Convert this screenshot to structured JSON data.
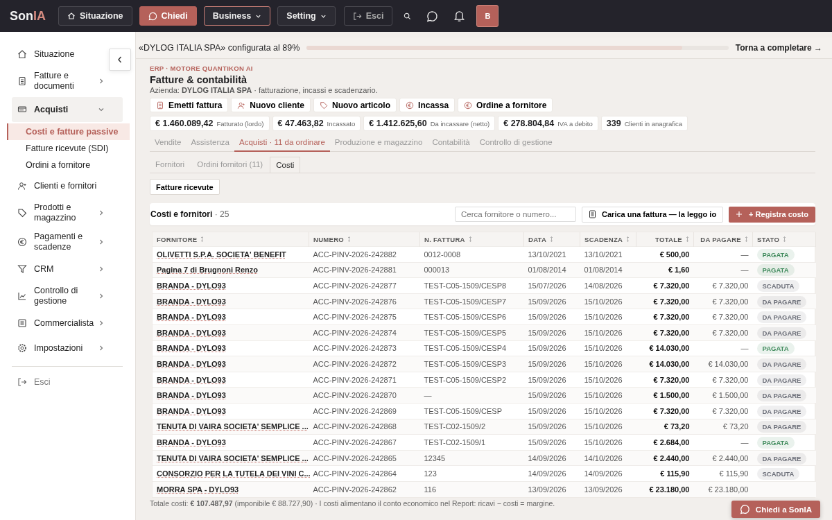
{
  "logo": {
    "main": "Son",
    "accent": "IA"
  },
  "nav": [
    {
      "label": "Situazione",
      "kind": "home",
      "selected": false
    },
    {
      "label": "Chiedi",
      "kind": "primary",
      "selected": false
    },
    {
      "label": "Business",
      "kind": "menu",
      "selected": true
    },
    {
      "label": "Setting",
      "kind": "menu",
      "selected": false
    },
    {
      "label": "Esci",
      "kind": "exit",
      "selected": false
    }
  ],
  "avatar": "B",
  "sidebar": {
    "items": [
      {
        "label": "Situazione"
      },
      {
        "label": "Fatture e documenti",
        "expanded": false
      },
      {
        "label": "Acquisti",
        "expanded": true,
        "children": [
          {
            "label": "Costi e fatture passive",
            "selected": true
          },
          {
            "label": "Fatture ricevute (SDI)",
            "selected": false
          },
          {
            "label": "Ordini a fornitore",
            "selected": false
          }
        ]
      },
      {
        "label": "Clienti e fornitori"
      },
      {
        "label": "Prodotti e magazzino",
        "expanded": false
      },
      {
        "label": "Pagamenti e scadenze",
        "expanded": false
      },
      {
        "label": "CRM",
        "expanded": false
      },
      {
        "label": "Controllo di gestione",
        "expanded": false
      },
      {
        "label": "Commercialista",
        "expanded": false
      },
      {
        "label": "Impostazioni",
        "expanded": false
      }
    ],
    "exit": "Esci"
  },
  "banner": {
    "text": "«DYLOG ITALIA SPA» configurata al 89%",
    "level": 0.89,
    "link": "Torna a completare →"
  },
  "header": {
    "eyebrow": "ERP · MOTORE QUANTIKON AI",
    "title": "Fatture & contabilità",
    "subtitle": "Azienda: **DYLOG ITALIA SPA** · fatturazione, incassi e scadenzario."
  },
  "actions": [
    "Emetti fattura",
    "Nuovo cliente",
    "Nuovo articolo",
    "Incassa",
    "Ordine a fornitore"
  ],
  "kpis": [
    {
      "value": "€ 1.460.089,42",
      "label": "Fatturato (lordo)"
    },
    {
      "value": "€ 47.463,82",
      "label": "Incassato"
    },
    {
      "value": "€ 1.412.625,60",
      "label": "Da incassare (netto)"
    },
    {
      "value": "€ 278.804,84",
      "label": "IVA a debito"
    },
    {
      "value": "339",
      "label": "Clienti in anagrafica"
    }
  ],
  "tabs": [
    {
      "label": "Vendite",
      "selected": false
    },
    {
      "label": "Assistenza",
      "selected": false
    },
    {
      "label": "Acquisti · 11 da ordinare",
      "selected": true
    },
    {
      "label": "Produzione e magazzino",
      "selected": false
    },
    {
      "label": "Contabilità",
      "selected": false
    },
    {
      "label": "Controllo di gestione",
      "selected": false
    }
  ],
  "subtabs": [
    {
      "label": "Fornitori",
      "selected": false
    },
    {
      "label": "Ordini fornitori (11)",
      "selected": false
    },
    {
      "label": "Costi",
      "selected": true
    }
  ],
  "filter_button": "Fatture ricevute",
  "card": {
    "title": "Costi e fornitori",
    "count": "· 25",
    "search": {
      "placeholder": "Cerca fornitore o numero..."
    },
    "upload_button": "Carica una fattura — la leggo io",
    "add_button": "+ Registra costo"
  },
  "table": {
    "columns": [
      "FORNITORE",
      "NUMERO",
      "N. FATTURA",
      "DATA",
      "SCADENZA",
      "TOTALE",
      "DA PAGARE",
      "STATO"
    ],
    "rows": [
      {
        "fornitore": "OLIVETTI S.P.A. SOCIETA' BENEFIT",
        "numero": "ACC-PINV-2026-242882",
        "fattura": "0012-0008",
        "data": "13/10/2021",
        "scadenza": "13/10/2021",
        "totale": "€ 500,00",
        "da_pagare": "—",
        "stato": "PAGATA",
        "color": "#3f8a5c"
      },
      {
        "fornitore": "Pagina 7 di Brugnoni Renzo",
        "numero": "ACC-PINV-2026-242881",
        "fattura": "000013",
        "data": "01/08/2014",
        "scadenza": "01/08/2014",
        "totale": "€ 1,60",
        "da_pagare": "—",
        "stato": "PAGATA",
        "color": "#3f8a5c"
      },
      {
        "fornitore": "BRANDA - DYLO93",
        "numero": "ACC-PINV-2026-242877",
        "fattura": "TEST-C05-1509/CESP8",
        "data": "15/07/2026",
        "scadenza": "14/08/2026",
        "totale": "€ 7.320,00",
        "da_pagare": "€ 7.320,00",
        "stato": "SCADUTA",
        "color": "#6b6e78"
      },
      {
        "fornitore": "BRANDA - DYLO93",
        "numero": "ACC-PINV-2026-242876",
        "fattura": "TEST-C05-1509/CESP7",
        "data": "15/09/2026",
        "scadenza": "15/10/2026",
        "totale": "€ 7.320,00",
        "da_pagare": "€ 7.320,00",
        "stato": "DA PAGARE",
        "color": "#6b6e78"
      },
      {
        "fornitore": "BRANDA - DYLO93",
        "numero": "ACC-PINV-2026-242875",
        "fattura": "TEST-C05-1509/CESP6",
        "data": "15/09/2026",
        "scadenza": "15/10/2026",
        "totale": "€ 7.320,00",
        "da_pagare": "€ 7.320,00",
        "stato": "DA PAGARE",
        "color": "#6b6e78"
      },
      {
        "fornitore": "BRANDA - DYLO93",
        "numero": "ACC-PINV-2026-242874",
        "fattura": "TEST-C05-1509/CESP5",
        "data": "15/09/2026",
        "scadenza": "15/10/2026",
        "totale": "€ 7.320,00",
        "da_pagare": "€ 7.320,00",
        "stato": "DA PAGARE",
        "color": "#6b6e78"
      },
      {
        "fornitore": "BRANDA - DYLO93",
        "numero": "ACC-PINV-2026-242873",
        "fattura": "TEST-C05-1509/CESP4",
        "data": "15/09/2026",
        "scadenza": "15/10/2026",
        "totale": "€ 14.030,00",
        "da_pagare": "—",
        "stato": "PAGATA",
        "color": "#3f8a5c"
      },
      {
        "fornitore": "BRANDA - DYLO93",
        "numero": "ACC-PINV-2026-242872",
        "fattura": "TEST-C05-1509/CESP3",
        "data": "15/09/2026",
        "scadenza": "15/10/2026",
        "totale": "€ 14.030,00",
        "da_pagare": "€ 14.030,00",
        "stato": "DA PAGARE",
        "color": "#6b6e78"
      },
      {
        "fornitore": "BRANDA - DYLO93",
        "numero": "ACC-PINV-2026-242871",
        "fattura": "TEST-C05-1509/CESP2",
        "data": "15/09/2026",
        "scadenza": "15/10/2026",
        "totale": "€ 7.320,00",
        "da_pagare": "€ 7.320,00",
        "stato": "DA PAGARE",
        "color": "#6b6e78"
      },
      {
        "fornitore": "BRANDA - DYLO93",
        "numero": "ACC-PINV-2026-242870",
        "fattura": "—",
        "data": "15/09/2026",
        "scadenza": "15/10/2026",
        "totale": "€ 1.500,00",
        "da_pagare": "€ 1.500,00",
        "stato": "DA PAGARE",
        "color": "#6b6e78"
      },
      {
        "fornitore": "BRANDA - DYLO93",
        "numero": "ACC-PINV-2026-242869",
        "fattura": "TEST-C05-1509/CESP",
        "data": "15/09/2026",
        "scadenza": "15/10/2026",
        "totale": "€ 7.320,00",
        "da_pagare": "€ 7.320,00",
        "stato": "DA PAGARE",
        "color": "#6b6e78"
      },
      {
        "fornitore": "TENUTA DI VAIRA SOCIETA' SEMPLICE ...",
        "numero": "ACC-PINV-2026-242868",
        "fattura": "TEST-C02-1509/2",
        "data": "15/09/2026",
        "scadenza": "15/10/2026",
        "totale": "€ 73,20",
        "da_pagare": "€ 73,20",
        "stato": "DA PAGARE",
        "color": "#6b6e78"
      },
      {
        "fornitore": "BRANDA - DYLO93",
        "numero": "ACC-PINV-2026-242867",
        "fattura": "TEST-C02-1509/1",
        "data": "15/09/2026",
        "scadenza": "15/10/2026",
        "totale": "€ 2.684,00",
        "da_pagare": "—",
        "stato": "PAGATA",
        "color": "#3f8a5c"
      },
      {
        "fornitore": "TENUTA DI VAIRA SOCIETA' SEMPLICE ...",
        "numero": "ACC-PINV-2026-242865",
        "fattura": "12345",
        "data": "14/09/2026",
        "scadenza": "14/10/2026",
        "totale": "€ 2.440,00",
        "da_pagare": "€ 2.440,00",
        "stato": "DA PAGARE",
        "color": "#6b6e78"
      },
      {
        "fornitore": "CONSORZIO PER LA TUTELA DEI VINI C...",
        "numero": "ACC-PINV-2026-242864",
        "fattura": "123",
        "data": "14/09/2026",
        "scadenza": "14/09/2026",
        "totale": "€ 115,90",
        "da_pagare": "€ 115,90",
        "stato": "SCADUTA",
        "color": "#6b6e78"
      },
      {
        "fornitore": "MORRA SPA - DYLO93",
        "numero": "ACC-PINV-2026-242862",
        "fattura": "116",
        "data": "13/09/2026",
        "scadenza": "13/09/2026",
        "totale": "€ 23.180,00",
        "da_pagare": "€ 23.180,00"
      }
    ]
  },
  "footer": "Totale costi: **€ 107.487,97** (imponibile € 88.727,90) · I costi alimentano il conto economico nel Report: ricavi − costi = margine.",
  "chat_button": "Chiedi a SonIA"
}
